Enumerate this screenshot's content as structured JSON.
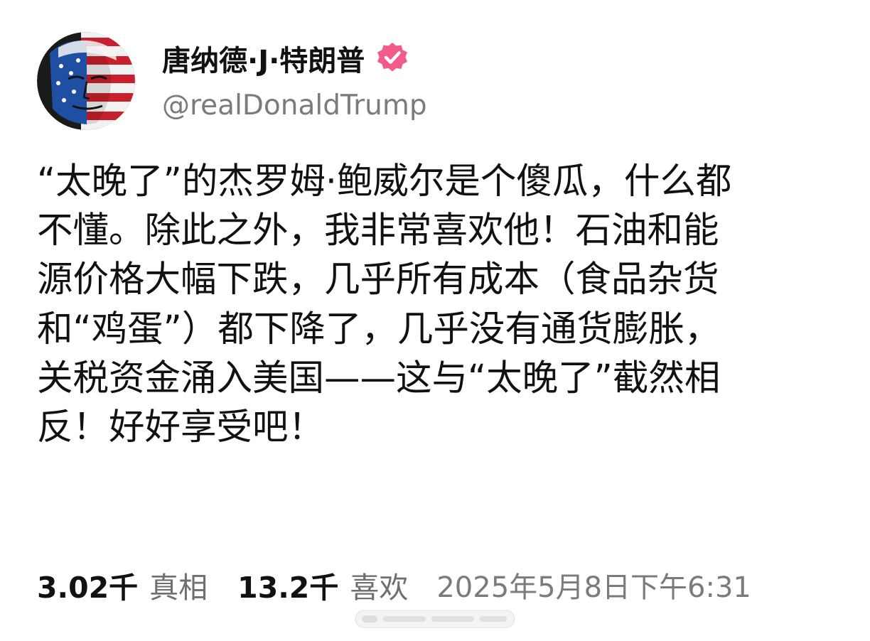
{
  "author": {
    "name": "唐纳德·J·特朗普",
    "handle": "@realDonaldTrump",
    "verified": true,
    "verified_color": "#f25c8a"
  },
  "post": {
    "lines": [
      "“太晚了”的杰罗姆·鲍威尔是个傻瓜，什么都",
      "不懂。除此之外，我非常喜欢他！石油和能",
      "源价格大幅下跌，几乎所有成本（食品杂货",
      "和“鸡蛋”）都下降了，几乎没有通货膨胀，",
      "关税资金涌入美国——这与“太晚了”截然相",
      "反！好好享受吧！"
    ]
  },
  "stats": {
    "truths_count": "3.02千",
    "truths_label": "真相",
    "likes_count": "13.2千",
    "likes_label": "喜欢"
  },
  "timestamp": "2025年5月8日下午6:31",
  "icons": {
    "avatar": "avatar-image",
    "verified": "verified-badge-icon"
  }
}
